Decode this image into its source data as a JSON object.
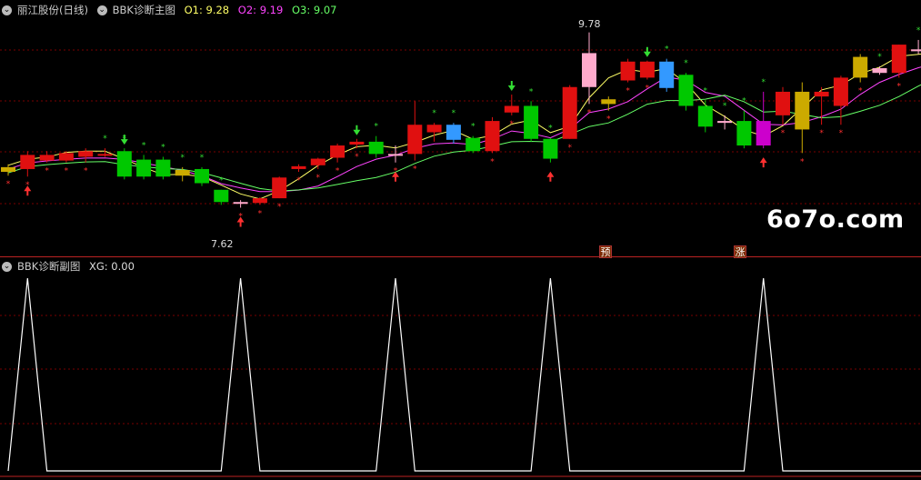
{
  "main_header": {
    "stock": "丽江股份(日线)",
    "indicator": "BBK诊断主图",
    "o1_label": "O1: 9.28",
    "o2_label": "O2: 9.19",
    "o3_label": "O3: 9.07"
  },
  "sub_header": {
    "indicator": "BBK诊断副图",
    "xg_label": "XG: 0.00"
  },
  "annotations": {
    "high_label": "9.78",
    "low_label": "7.62",
    "badge_yu": "预",
    "badge_zhang": "涨"
  },
  "watermark": "6o7o.com",
  "colors": {
    "background": "#000000",
    "rise": "#e01010",
    "fall": "#00c800",
    "o1": "#ffff66",
    "o2": "#ff44ff",
    "o3": "#66ff66",
    "xg": "#ffffff",
    "grid": "#7a0000"
  },
  "chart_data": [
    {
      "type": "candlestick",
      "title": "BBK诊断主图",
      "price_range": [
        7.5,
        9.95
      ],
      "candles": [
        [
          8.3,
          8.35,
          8.26,
          8.38,
          "#ccaa00"
        ],
        [
          8.33,
          8.48,
          8.25,
          8.52,
          "#e01010"
        ],
        [
          8.42,
          8.48,
          8.4,
          8.52,
          "#e01010"
        ],
        [
          8.42,
          8.5,
          8.4,
          8.52,
          "#e01010"
        ],
        [
          8.46,
          8.52,
          8.4,
          8.55,
          "#e01010"
        ],
        [
          8.49,
          8.48,
          8.46,
          8.55,
          "#e01010"
        ],
        [
          8.52,
          8.25,
          8.22,
          8.55,
          "#00c800"
        ],
        [
          8.43,
          8.25,
          8.22,
          8.48,
          "#00c800"
        ],
        [
          8.43,
          8.25,
          8.22,
          8.46,
          "#00c800"
        ],
        [
          8.32,
          8.26,
          8.2,
          8.35,
          "#ccaa00"
        ],
        [
          8.33,
          8.18,
          8.15,
          8.35,
          "#00c800"
        ],
        [
          8.11,
          7.98,
          7.95,
          8.11,
          "#00c800"
        ],
        [
          7.98,
          7.98,
          7.92,
          8.0,
          "#ffaacc"
        ],
        [
          7.97,
          8.02,
          7.95,
          8.03,
          "#e01010"
        ],
        [
          8.02,
          8.24,
          8.02,
          8.25,
          "#e01010"
        ],
        [
          8.33,
          8.36,
          8.3,
          8.38,
          "#e01010"
        ],
        [
          8.37,
          8.44,
          8.33,
          8.45,
          "#e01010"
        ],
        [
          8.45,
          8.58,
          8.4,
          8.6,
          "#e01010"
        ],
        [
          8.59,
          8.62,
          8.55,
          8.65,
          "#e01010"
        ],
        [
          8.62,
          8.49,
          8.45,
          8.68,
          "#00c800"
        ],
        [
          8.48,
          8.49,
          8.4,
          8.58,
          "#ffaacc"
        ],
        [
          8.49,
          8.8,
          8.42,
          9.05,
          "#e01010"
        ],
        [
          8.8,
          8.72,
          8.62,
          8.82,
          "#e01010"
        ],
        [
          8.8,
          8.64,
          8.6,
          8.82,
          "#3399ff"
        ],
        [
          8.66,
          8.52,
          8.5,
          8.68,
          "#00c800"
        ],
        [
          8.52,
          8.84,
          8.5,
          8.88,
          "#e01010"
        ],
        [
          8.93,
          9.0,
          8.9,
          9.12,
          "#e01010"
        ],
        [
          9.0,
          8.65,
          8.62,
          9.05,
          "#00c800"
        ],
        [
          8.65,
          8.44,
          8.4,
          8.66,
          "#00c800"
        ],
        [
          8.65,
          9.2,
          8.65,
          9.22,
          "#e01010"
        ],
        [
          9.2,
          9.56,
          9.02,
          9.78,
          "#ffaacc"
        ],
        [
          9.02,
          9.07,
          8.95,
          9.1,
          "#ccaa00"
        ],
        [
          9.27,
          9.47,
          9.25,
          9.5,
          "#e01010"
        ],
        [
          9.3,
          9.47,
          9.28,
          9.48,
          "#e01010"
        ],
        [
          9.47,
          9.19,
          9.15,
          9.5,
          "#3399ff"
        ],
        [
          9.33,
          9.0,
          8.95,
          9.35,
          "#00c800"
        ],
        [
          9.0,
          8.78,
          8.72,
          9.06,
          "#00c800"
        ],
        [
          8.84,
          8.82,
          8.75,
          8.9,
          "#ffaacc"
        ],
        [
          8.84,
          8.58,
          8.55,
          8.95,
          "#00c800"
        ],
        [
          8.84,
          8.58,
          8.55,
          9.15,
          "#cc00cc"
        ],
        [
          8.9,
          9.15,
          8.8,
          9.2,
          "#e01010"
        ],
        [
          8.75,
          9.15,
          8.5,
          9.25,
          "#ccaa00"
        ],
        [
          9.1,
          9.15,
          8.8,
          9.2,
          "#e01010"
        ],
        [
          9.0,
          9.3,
          8.8,
          9.32,
          "#e01010"
        ],
        [
          9.3,
          9.52,
          9.25,
          9.55,
          "#ccaa00"
        ],
        [
          9.4,
          9.35,
          9.33,
          9.42,
          "#ffaacc"
        ],
        [
          9.35,
          9.65,
          9.3,
          9.65,
          "#e01010"
        ],
        [
          9.6,
          9.58,
          9.55,
          9.7,
          "#ffaacc"
        ],
        [
          9.6,
          9.45,
          9.4,
          9.72,
          "#00c800"
        ]
      ]
    },
    {
      "type": "line",
      "title": "BBK诊断副图",
      "series": [
        {
          "name": "XG",
          "values": [
            0,
            1,
            0,
            0,
            0,
            0,
            0,
            0,
            0,
            0,
            0,
            0,
            1,
            0,
            0,
            0,
            0,
            0,
            0,
            0,
            1,
            0,
            0,
            0,
            0,
            0,
            0,
            0,
            1,
            0,
            0,
            0,
            0,
            0,
            0,
            0,
            0,
            0,
            0,
            1,
            0,
            0,
            0,
            0,
            0,
            0,
            0,
            0,
            0
          ]
        }
      ]
    }
  ]
}
